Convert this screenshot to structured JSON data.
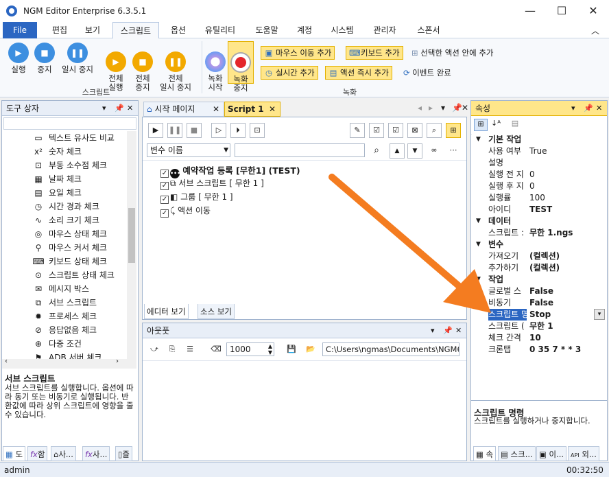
{
  "app": {
    "title": "NGM Editor   Enterprise 6.3.5.1",
    "user": "admin",
    "time": "00:32:50"
  },
  "window": {
    "minimize": "—",
    "maximize": "☐",
    "close": "✕"
  },
  "menu": {
    "file": "File",
    "tabs": [
      "편집",
      "보기",
      "스크립트",
      "옵션",
      "유틸리티",
      "도움말",
      "계정",
      "시스템",
      "관리자",
      "스폰서"
    ]
  },
  "ribbon": {
    "script_group": "스크립트",
    "record_group": "녹화",
    "buttons": {
      "run": "실행",
      "stop": "중지",
      "pause": "일시 중지",
      "run_all": "전체\n실행",
      "stop_all": "전체\n중지",
      "pause_all": "전체\n일시 중지",
      "rec_start": "녹화\n시작",
      "rec_stop": "녹화\n중지"
    },
    "small": {
      "mouse_move": "마우스 이동 추가",
      "keyboard": "키보드 추가",
      "selected_action": "선택한 액션 안에 추가",
      "realtime": "실시간 추가",
      "action_now": "액션 즉시 추가",
      "event_done": "이벤트 완료"
    }
  },
  "toolbox": {
    "title": "도구 상자",
    "items": [
      "텍스트 유사도 비교",
      "숫자 체크",
      "부동 소수점 체크",
      "날짜 체크",
      "요일 체크",
      "시간 경과 체크",
      "소리 크기 체크",
      "마우스 상태 체크",
      "마우스 커서 체크",
      "키보드 상태 체크",
      "스크립트 상태 체크",
      "메시지 박스",
      "서브 스크립트",
      "프로세스 체크",
      "응답없음 체크",
      "다중 조건",
      "ADB 서버 체크"
    ],
    "desc_title": "서브 스크립트",
    "desc": "서브 스크립트를 실행합니다. 옵션에 따라 동기 또는 비동기로 실행됩니다. 반환값에 따라 상위 스크립트에 영향을 줄 수 있습니다.",
    "bottom_tabs": [
      "도",
      "함",
      "사...",
      "사...",
      "즐"
    ]
  },
  "editor": {
    "tabs": [
      "시작 페이지",
      "Script 1"
    ],
    "var_select": "변수 이름",
    "search_value": "",
    "tree": [
      {
        "label": "예약작업 등록 [무한1] (TEST)"
      },
      {
        "label": "서브 스크립트 [ 무한 1 ]"
      },
      {
        "label": "그룹 [ 무한 1 ]"
      },
      {
        "label": "액션 이동"
      }
    ],
    "bottom_tabs": [
      "에디터 보기",
      "소스 보기"
    ]
  },
  "output": {
    "title": "아웃풋",
    "count": "1000",
    "path": "C:\\Users\\ngmas\\Documents\\NGM6\\"
  },
  "props": {
    "title": "속성",
    "cats": [
      {
        "name": "기본 작업",
        "rows": [
          [
            "사용 여부",
            "True"
          ],
          [
            "설명",
            ""
          ],
          [
            "실행 전 지",
            "0"
          ],
          [
            "실행 후 지",
            "0"
          ],
          [
            "실행률",
            "100"
          ],
          [
            "아이디",
            "TEST"
          ]
        ]
      },
      {
        "name": "데이터",
        "rows": [
          [
            "스크립트 :",
            "무한 1.ngs"
          ]
        ]
      },
      {
        "name": "변수",
        "rows": [
          [
            "가져오기",
            "(컬렉션)"
          ],
          [
            "추가하기",
            "(컬렉션)"
          ]
        ]
      },
      {
        "name": "작업",
        "rows": [
          [
            "글로벌 스",
            "False"
          ],
          [
            "비동기",
            "False"
          ],
          [
            "스크립트 명",
            "Stop"
          ],
          [
            "스크립트 (",
            "무한 1"
          ],
          [
            "체크 간격",
            "10"
          ],
          [
            "크론탭",
            "0 35 7 * * 3"
          ]
        ]
      }
    ],
    "desc_title": "스크립트 명령",
    "desc": "스크립트를 실행하거나 중지합니다.",
    "bottom_tabs": [
      "속",
      "스크...",
      "이...",
      "외..."
    ]
  },
  "colors": {
    "arrow": "#f47c20",
    "accent": "#2b66c2"
  }
}
